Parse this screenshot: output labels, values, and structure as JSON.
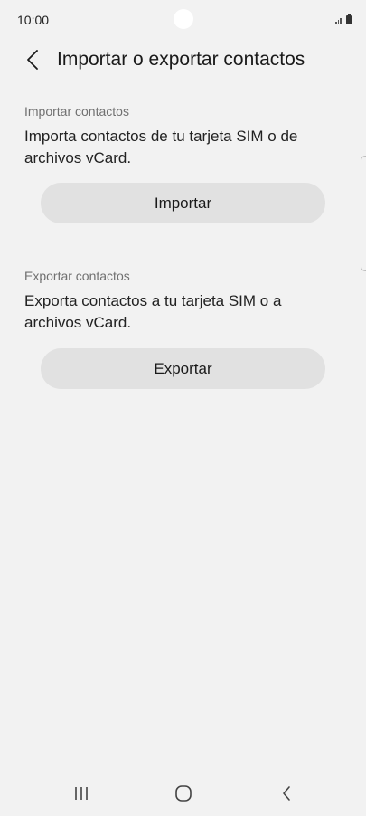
{
  "status_bar": {
    "time": "10:00"
  },
  "header": {
    "title": "Importar o exportar contactos",
    "back_icon": "chevron-left-icon"
  },
  "import_section": {
    "label": "Importar contactos",
    "description": "Importa contactos de tu tarjeta SIM o de archivos vCard.",
    "button_label": "Importar"
  },
  "export_section": {
    "label": "Exportar contactos",
    "description": "Exporta contactos a tu tarjeta SIM o a archivos vCard.",
    "button_label": "Exportar"
  },
  "nav_bar": {
    "recents_icon": "recents-icon",
    "home_icon": "home-icon",
    "back_icon": "back-icon"
  },
  "colors": {
    "background": "#f2f2f2",
    "button_background": "#e1e1e1",
    "label_gray": "#707070"
  }
}
